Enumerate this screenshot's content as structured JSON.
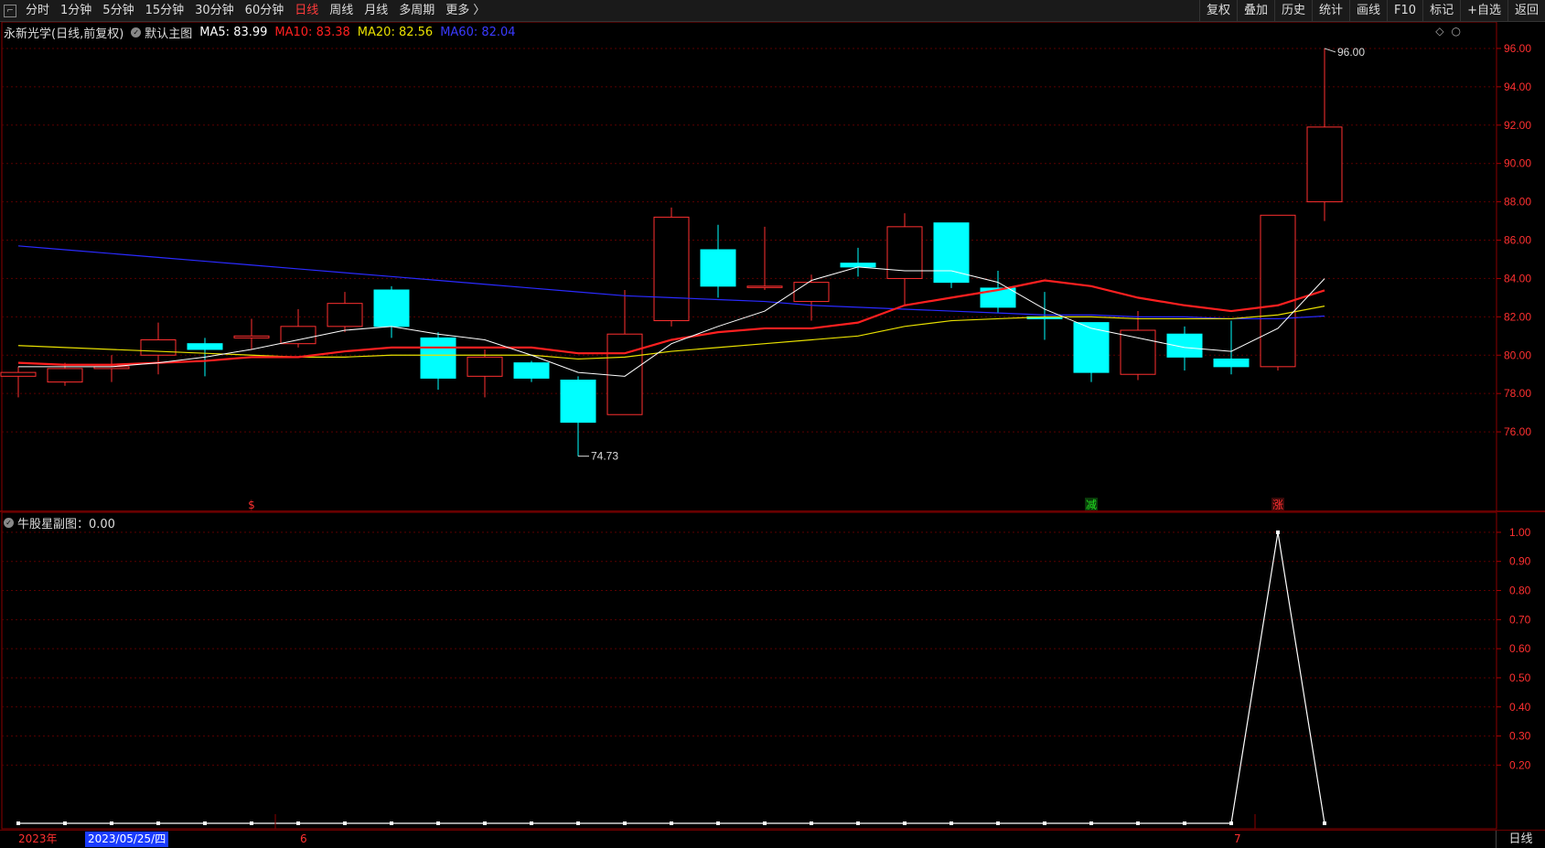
{
  "toolbar": {
    "corner_icon": "window-menu-icon",
    "periods": [
      "分时",
      "1分钟",
      "5分钟",
      "15分钟",
      "30分钟",
      "60分钟",
      "日线",
      "周线",
      "月线",
      "多周期",
      "更多 〉"
    ],
    "active_period": "日线",
    "right_buttons": [
      "复权",
      "叠加",
      "历史",
      "统计",
      "画线",
      "F10",
      "标记",
      "+自选",
      "返回"
    ]
  },
  "main_chart": {
    "stock_name": "永新光学(日线,前复权)",
    "template": "默认主图",
    "ma5_label": "MA5: 83.99",
    "ma10_label": "MA10: 83.38",
    "ma20_label": "MA20: 82.56",
    "ma60_label": "MA60: 82.04",
    "price_labels": [
      "96.00",
      "94.00",
      "92.00",
      "90.00",
      "88.00",
      "86.00",
      "84.00",
      "82.00",
      "80.00",
      "78.00",
      "76.00"
    ],
    "high_marker": "96.00",
    "low_marker": "74.73",
    "signals": [
      {
        "text": "$",
        "color": "#ff3030"
      },
      {
        "text": "减",
        "color": "#20e020"
      },
      {
        "text": "涨",
        "color": "#ff3030"
      }
    ]
  },
  "sub_chart": {
    "title": "牛股星副图：0.00",
    "value_labels": [
      "1.00",
      "0.90",
      "0.80",
      "0.70",
      "0.60",
      "0.50",
      "0.40",
      "0.30",
      "0.20"
    ]
  },
  "bottom_bar": {
    "year_label": "2023年",
    "cursor_date": "2023/05/25/四",
    "month_6": "6",
    "month_7": "7",
    "period_button": "日线"
  },
  "colors": {
    "up": "#ff3030",
    "down": "#00ffff",
    "ma5": "#ffffff",
    "ma10": "#ff2020",
    "ma20": "#e8e000",
    "ma60": "#2a2aff",
    "grid": "#5a0000"
  },
  "chart_data": {
    "type": "candlestick",
    "candles": [
      {
        "o": 78.9,
        "c": 79.1,
        "h": 79.4,
        "l": 77.8
      },
      {
        "o": 78.6,
        "c": 79.3,
        "h": 79.6,
        "l": 78.4
      },
      {
        "o": 79.3,
        "c": 79.4,
        "h": 80.0,
        "l": 78.6
      },
      {
        "o": 80.0,
        "c": 80.8,
        "h": 81.7,
        "l": 79.0
      },
      {
        "o": 80.6,
        "c": 80.3,
        "h": 80.9,
        "l": 78.9
      },
      {
        "o": 80.9,
        "c": 81.0,
        "h": 81.9,
        "l": 80.3
      },
      {
        "o": 80.6,
        "c": 81.5,
        "h": 82.4,
        "l": 80.4
      },
      {
        "o": 81.5,
        "c": 82.7,
        "h": 83.3,
        "l": 81.2
      },
      {
        "o": 83.4,
        "c": 81.5,
        "h": 83.6,
        "l": 80.9
      },
      {
        "o": 80.9,
        "c": 78.8,
        "h": 81.2,
        "l": 78.2
      },
      {
        "o": 78.9,
        "c": 79.9,
        "h": 80.3,
        "l": 77.8
      },
      {
        "o": 79.6,
        "c": 78.8,
        "h": 79.7,
        "l": 78.6
      },
      {
        "o": 78.7,
        "c": 76.5,
        "h": 78.9,
        "l": 74.73
      },
      {
        "o": 76.9,
        "c": 81.1,
        "h": 83.4,
        "l": 76.9
      },
      {
        "o": 81.8,
        "c": 87.2,
        "h": 87.7,
        "l": 81.5
      },
      {
        "o": 85.5,
        "c": 83.6,
        "h": 86.8,
        "l": 83.0
      },
      {
        "o": 83.6,
        "c": 83.6,
        "h": 86.7,
        "l": 83.4
      },
      {
        "o": 82.8,
        "c": 83.8,
        "h": 84.2,
        "l": 81.8
      },
      {
        "o": 84.8,
        "c": 84.6,
        "h": 85.6,
        "l": 84.1
      },
      {
        "o": 84.0,
        "c": 86.7,
        "h": 87.4,
        "l": 82.6
      },
      {
        "o": 86.9,
        "c": 83.8,
        "h": 86.9,
        "l": 83.5
      },
      {
        "o": 83.5,
        "c": 82.5,
        "h": 84.4,
        "l": 82.2
      },
      {
        "o": 82.0,
        "c": 81.9,
        "h": 83.3,
        "l": 80.8
      },
      {
        "o": 81.7,
        "c": 79.1,
        "h": 81.7,
        "l": 78.6
      },
      {
        "o": 79.0,
        "c": 81.3,
        "h": 82.3,
        "l": 78.7
      },
      {
        "o": 81.1,
        "c": 79.9,
        "h": 81.5,
        "l": 79.2
      },
      {
        "o": 79.8,
        "c": 79.4,
        "h": 81.8,
        "l": 79.0
      },
      {
        "o": 79.4,
        "c": 87.3,
        "h": 87.3,
        "l": 79.2
      },
      {
        "o": 88.0,
        "c": 91.9,
        "h": 96.0,
        "l": 87.0
      }
    ],
    "ma5": [
      79.4,
      79.4,
      79.4,
      79.6,
      79.9,
      80.3,
      80.8,
      81.3,
      81.5,
      81.1,
      80.8,
      80.0,
      79.1,
      78.9,
      80.6,
      81.5,
      82.3,
      83.9,
      84.6,
      84.4,
      84.4,
      83.8,
      82.4,
      81.4,
      80.9,
      80.4,
      80.2,
      81.4,
      83.99
    ],
    "ma10": [
      79.6,
      79.5,
      79.5,
      79.6,
      79.7,
      79.9,
      79.9,
      80.2,
      80.4,
      80.4,
      80.4,
      80.4,
      80.1,
      80.1,
      80.8,
      81.2,
      81.4,
      81.4,
      81.7,
      82.6,
      83.0,
      83.4,
      83.9,
      83.6,
      83.0,
      82.6,
      82.3,
      82.6,
      83.38
    ],
    "ma20": [
      80.5,
      80.4,
      80.3,
      80.2,
      80.1,
      80.0,
      79.9,
      79.9,
      80.0,
      80.0,
      80.0,
      80.0,
      79.8,
      79.9,
      80.2,
      80.4,
      80.6,
      80.8,
      81.0,
      81.5,
      81.8,
      81.9,
      82.0,
      82.0,
      81.9,
      81.9,
      81.9,
      82.1,
      82.56
    ],
    "ma60": [
      85.7,
      85.5,
      85.3,
      85.1,
      84.9,
      84.7,
      84.5,
      84.3,
      84.1,
      83.9,
      83.7,
      83.5,
      83.3,
      83.1,
      83.0,
      82.9,
      82.8,
      82.6,
      82.5,
      82.4,
      82.3,
      82.2,
      82.1,
      82.1,
      82.0,
      82.0,
      81.9,
      81.9,
      82.04
    ],
    "signal_candles": [
      5,
      23,
      27
    ],
    "y_range": [
      74.0,
      97.0
    ],
    "sub_values": [
      0,
      0,
      0,
      0,
      0,
      0,
      0,
      0,
      0,
      0,
      0,
      0,
      0,
      0,
      0,
      0,
      0,
      0,
      0,
      0,
      0,
      0,
      0,
      0,
      0,
      0,
      0,
      1,
      0
    ],
    "sub_range": [
      0.0,
      1.05
    ]
  }
}
